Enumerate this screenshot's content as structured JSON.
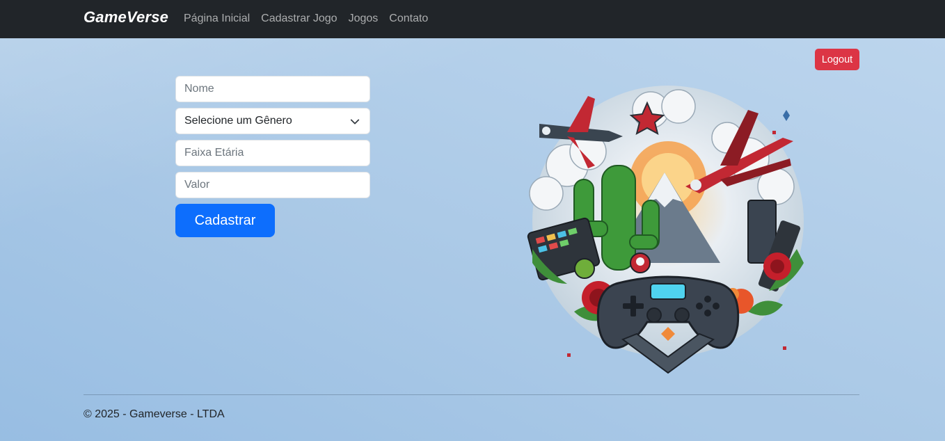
{
  "navbar": {
    "brand": "GameVerse",
    "links": [
      "Página Inicial",
      "Cadastrar Jogo",
      "Jogos",
      "Contato"
    ]
  },
  "logout_label": "Logout",
  "form": {
    "name_placeholder": "Nome",
    "genre_selected": "Selecione um Gênero",
    "age_placeholder": "Faixa Etária",
    "price_placeholder": "Valor",
    "submit_label": "Cadastrar"
  },
  "footer": {
    "text": "© 2025 - Gameverse - LTDA"
  },
  "colors": {
    "navbar": "#212529",
    "logout": "#dc3545",
    "primary": "#0d6efd",
    "background": "#a9c8e6"
  }
}
